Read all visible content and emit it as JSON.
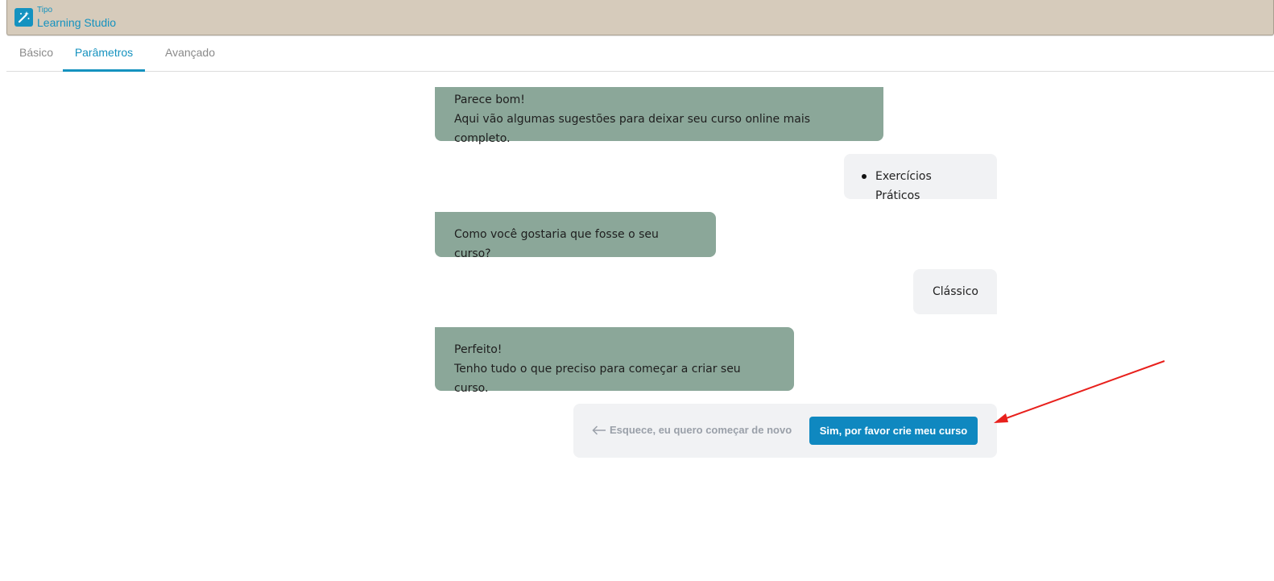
{
  "app": {
    "kind": "Tipo",
    "name": "Learning Studio",
    "accent": "#1592bf",
    "icon": "magic-wand-icon"
  },
  "tabs": [
    {
      "label": "Básico",
      "active": false
    },
    {
      "label": "Parâmetros",
      "active": true
    },
    {
      "label": "Avançado",
      "active": false
    }
  ],
  "chat": {
    "bot_color": "#8ba799",
    "user_color": "#f1f2f4",
    "messages": [
      {
        "from": "bot",
        "lines": [
          "Parece bom!",
          "Aqui vão algumas sugestões para deixar seu curso online mais completo."
        ]
      },
      {
        "from": "user",
        "list": [
          "Exercícios Práticos"
        ]
      },
      {
        "from": "bot",
        "lines": [
          "Como você gostaria que fosse o seu curso?"
        ]
      },
      {
        "from": "user",
        "lines": [
          "Clássico"
        ]
      },
      {
        "from": "bot",
        "lines": [
          "Perfeito!",
          "Tenho tudo o que preciso para começar a criar seu curso."
        ]
      }
    ]
  },
  "confirm": {
    "restart_label": "Esquece, eu quero começar de novo",
    "restart_icon": "arrow-left-icon",
    "create_label": "Sim, por favor crie meu curso",
    "button_color": "#0f88c0"
  },
  "annotation": {
    "arrow_color": "#e8201c"
  }
}
